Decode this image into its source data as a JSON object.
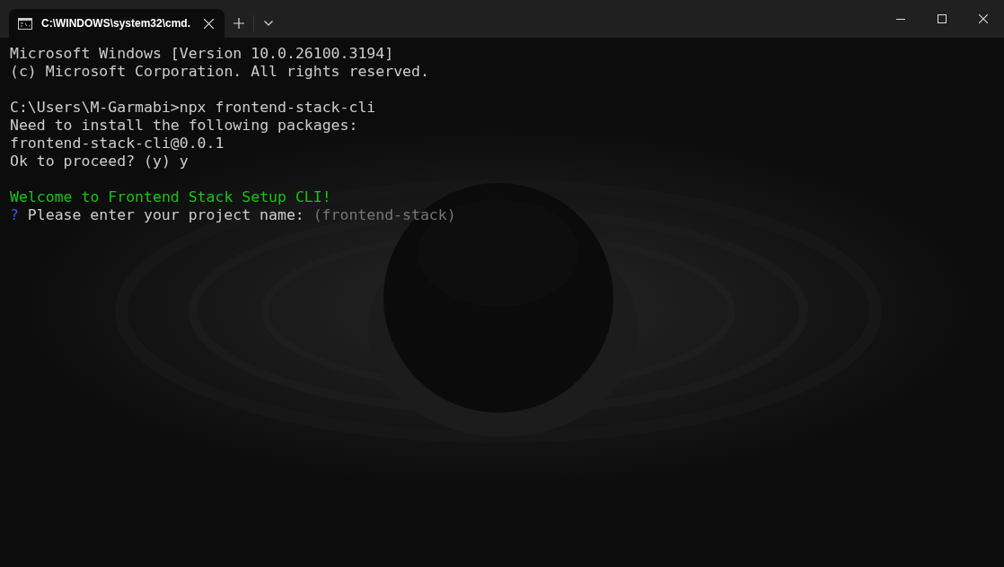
{
  "tabs": [
    {
      "title": "C:\\WINDOWS\\system32\\cmd.",
      "selected": true
    }
  ],
  "terminal": {
    "lines": [
      {
        "kind": "text",
        "segments": [
          {
            "kind": "output",
            "text": "Microsoft Windows [Version 10.0.26100.3194]"
          }
        ]
      },
      {
        "kind": "text",
        "segments": [
          {
            "kind": "output",
            "text": "(c) Microsoft Corporation. All rights reserved."
          }
        ]
      },
      {
        "kind": "blank"
      },
      {
        "kind": "text",
        "segments": [
          {
            "kind": "output",
            "text": "C:\\Users\\M-Garmabi>npx frontend-stack-cli"
          }
        ]
      },
      {
        "kind": "text",
        "segments": [
          {
            "kind": "output",
            "text": "Need to install the following packages:"
          }
        ]
      },
      {
        "kind": "text",
        "segments": [
          {
            "kind": "output",
            "text": "frontend-stack-cli@0.0.1"
          }
        ]
      },
      {
        "kind": "text",
        "segments": [
          {
            "kind": "output",
            "text": "Ok to proceed? (y) y"
          }
        ]
      },
      {
        "kind": "blank"
      },
      {
        "kind": "text",
        "segments": [
          {
            "kind": "success",
            "text": "Welcome to Frontend Stack Setup CLI!"
          }
        ]
      },
      {
        "kind": "text",
        "segments": [
          {
            "kind": "prompt",
            "text": "?"
          },
          {
            "kind": "output",
            "text": "Please enter your project name:"
          },
          {
            "kind": "hint",
            "text": "(frontend-stack)"
          }
        ]
      }
    ]
  }
}
